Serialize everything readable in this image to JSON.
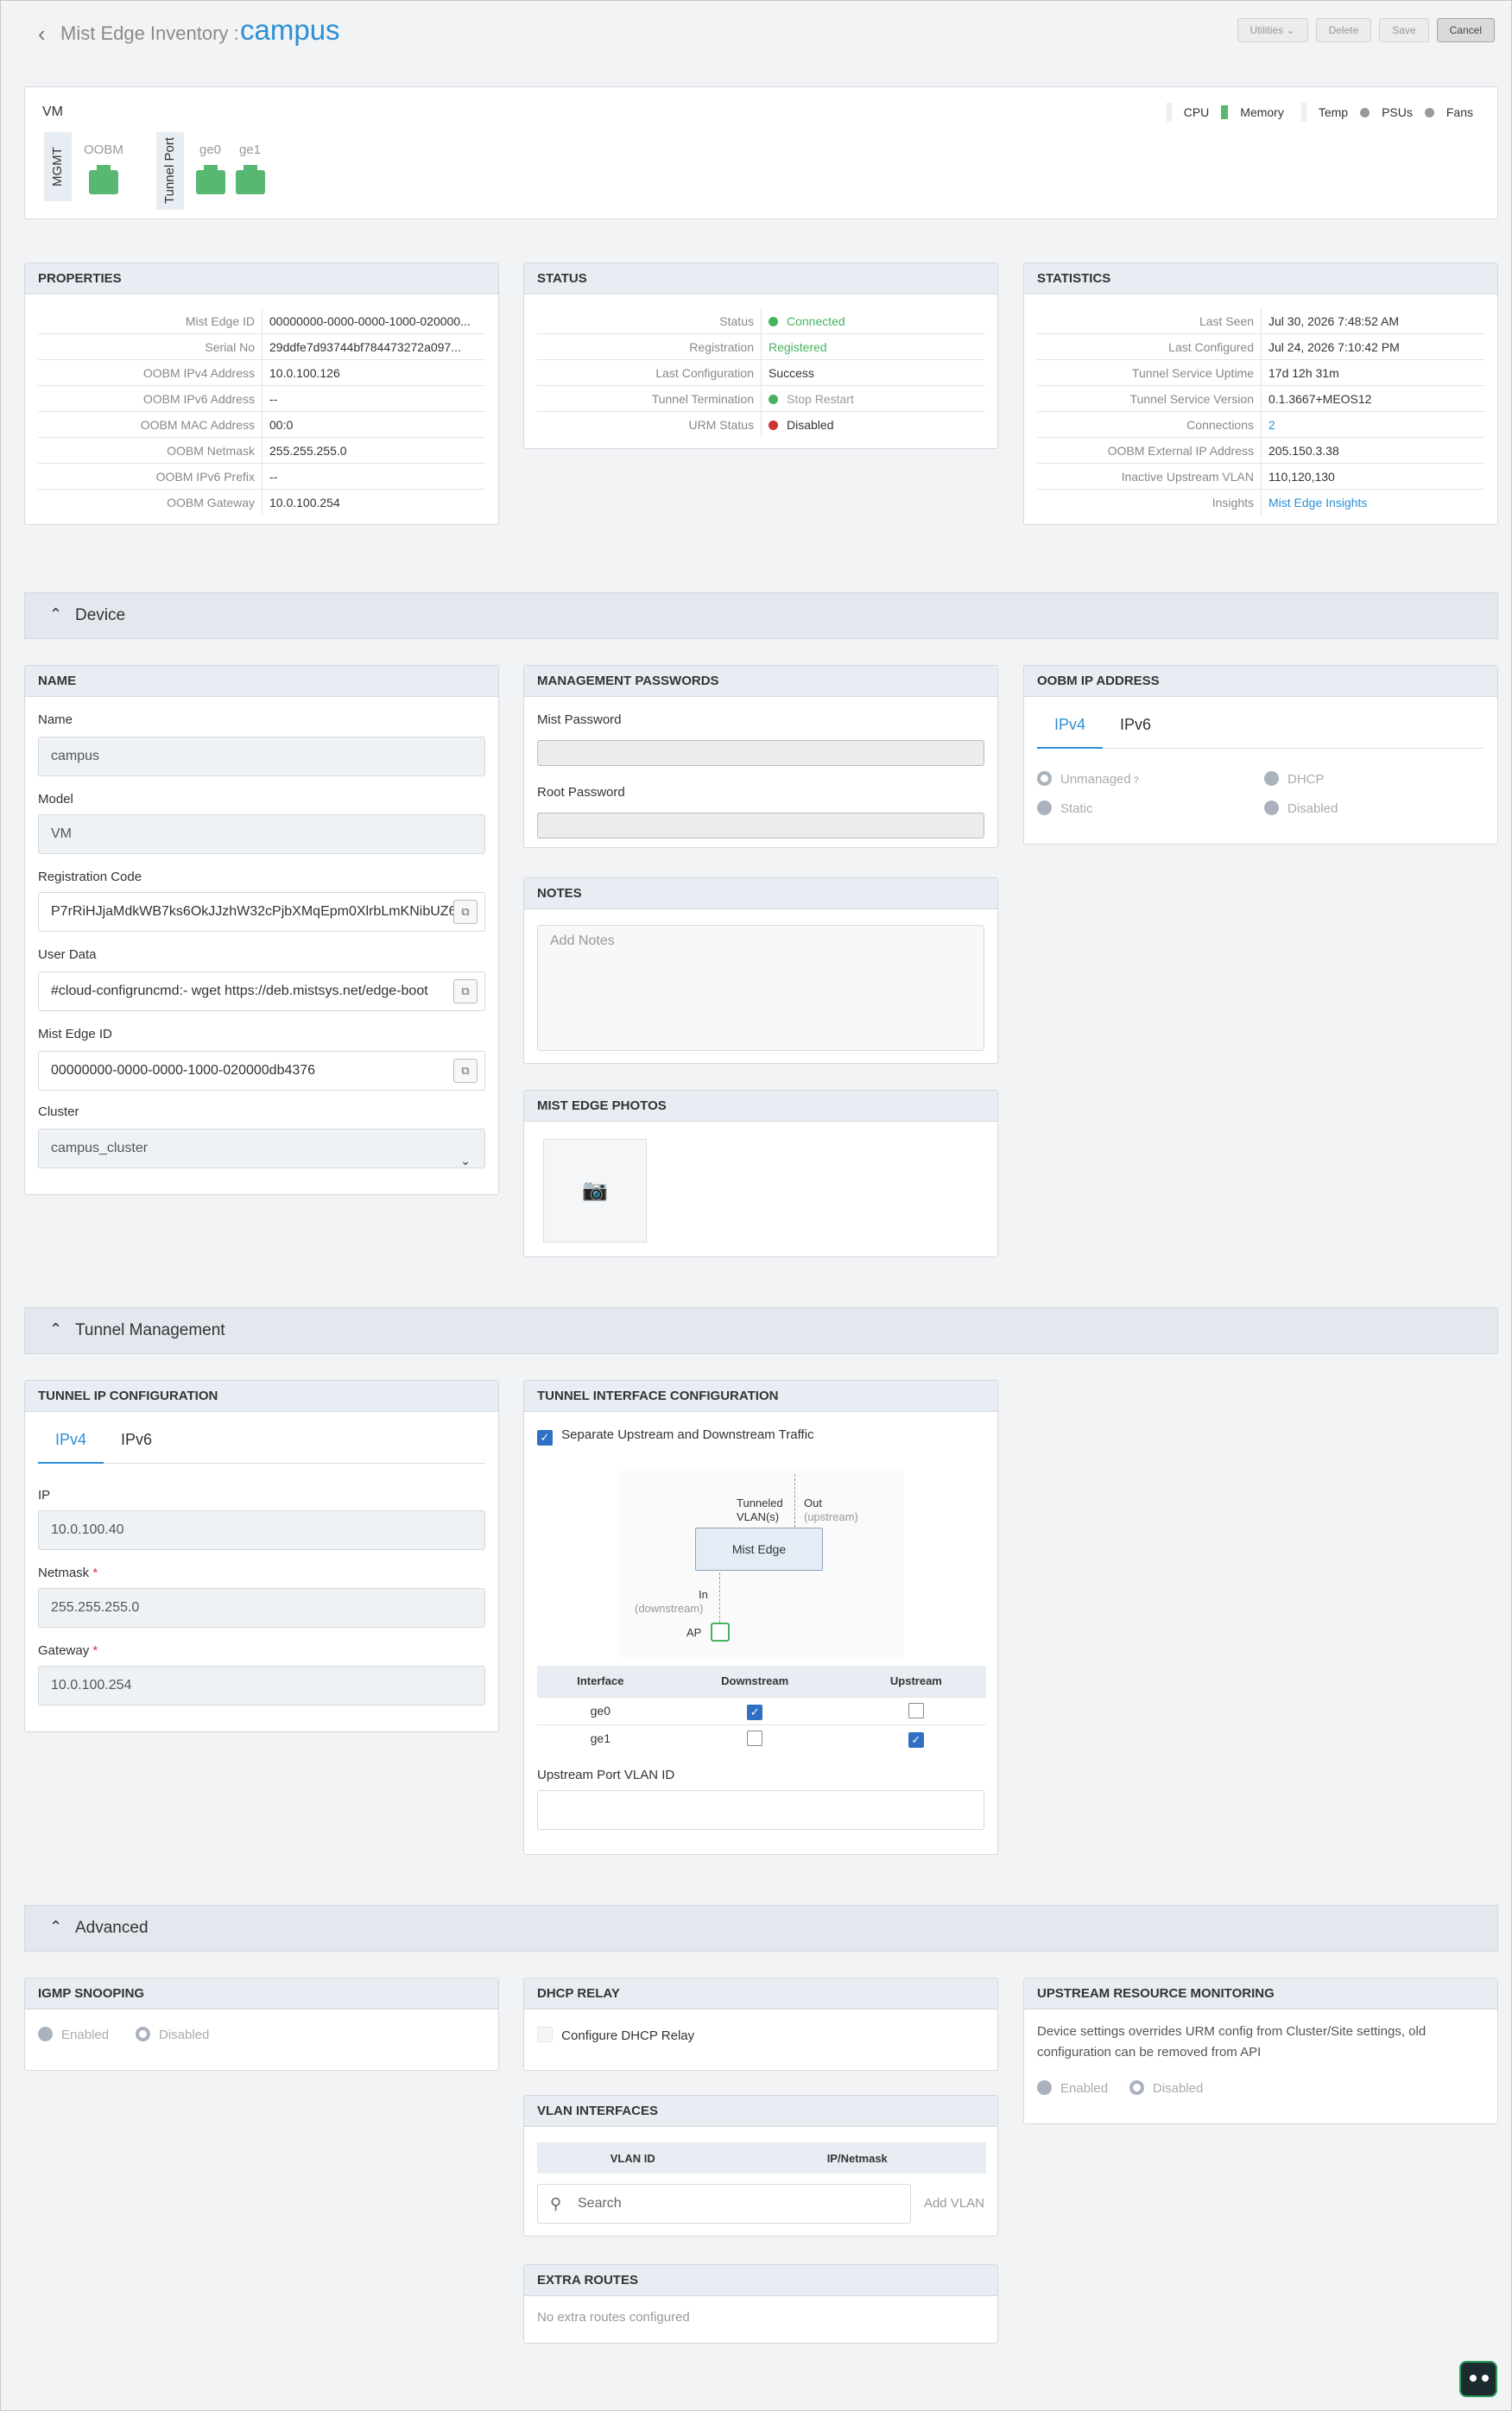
{
  "header": {
    "back_icon": "chevron-left-icon",
    "breadcrumb": "Mist Edge Inventory :",
    "title": "campus",
    "buttons": {
      "utilities": "Utilities ⌄",
      "delete": "Delete",
      "save": "Save",
      "cancel": "Cancel"
    }
  },
  "vm": {
    "label": "VM",
    "legend": [
      "CPU",
      "Memory",
      "Temp",
      "PSUs",
      "Fans"
    ],
    "mgmt_label": "MGMT",
    "oobm_label": "OOBM",
    "tunnel_label": "Tunnel Port",
    "ports": [
      "ge0",
      "ge1"
    ],
    "port_color": "#58b872"
  },
  "properties": {
    "title": "PROPERTIES",
    "rows": [
      {
        "k": "Mist Edge ID",
        "v": "00000000-0000-0000-1000-020000..."
      },
      {
        "k": "Serial No",
        "v": "29ddfe7d93744bf784473272a097..."
      },
      {
        "k": "OOBM IPv4 Address",
        "v": "10.0.100.126"
      },
      {
        "k": "OOBM IPv6 Address",
        "v": "--"
      },
      {
        "k": "OOBM MAC Address",
        "v": "00:0"
      },
      {
        "k": "OOBM Netmask",
        "v": "255.255.255.0"
      },
      {
        "k": "OOBM IPv6 Prefix",
        "v": "--"
      },
      {
        "k": "OOBM Gateway",
        "v": "10.0.100.254"
      }
    ]
  },
  "status": {
    "title": "STATUS",
    "rows": [
      {
        "k": "Status",
        "v": "Connected"
      },
      {
        "k": "Registration",
        "v": "Registered"
      },
      {
        "k": "Last Configuration",
        "v": "Success"
      },
      {
        "k": "Tunnel Termination",
        "v": "Stop Restart"
      },
      {
        "k": "URM Status",
        "v": "Disabled"
      }
    ],
    "colors": {
      "connected": "#45b35e",
      "disabled": "#cc3333"
    }
  },
  "statistics": {
    "title": "STATISTICS",
    "rows": [
      {
        "k": "Last Seen",
        "v": "Jul 30, 2026 7:48:52 AM"
      },
      {
        "k": "Last Configured",
        "v": "Jul 24, 2026 7:10:42 PM"
      },
      {
        "k": "Tunnel Service Uptime",
        "v": "17d 12h 31m"
      },
      {
        "k": "Tunnel Service Version",
        "v": "0.1.3667+MEOS12"
      },
      {
        "k": "Connections",
        "v": "2"
      },
      {
        "k": "OOBM External IP Address",
        "v": "205.150.3.38"
      },
      {
        "k": "Inactive Upstream VLAN",
        "v": "110,120,130"
      },
      {
        "k": "Insights",
        "v": "Mist Edge Insights"
      }
    ]
  },
  "sections": {
    "device": "Device",
    "tunnel": "Tunnel Management",
    "advanced": "Advanced"
  },
  "name_panel": {
    "title": "NAME",
    "name_label": "Name",
    "name_value": "campus",
    "model_label": "Model",
    "model_value": "VM",
    "reg_label": "Registration Code",
    "reg_value": "P7rRiHJjaMdkWB7ks6OkJJzhW32cPjbXMqEpm0XlrbLmKNibUZ6",
    "userdata_label": "User Data",
    "userdata_value": "#cloud-configruncmd:- wget https://deb.mistsys.net/edge-boot",
    "edgeid_label": "Mist Edge ID",
    "edgeid_value": "00000000-0000-0000-1000-020000db4376",
    "cluster_label": "Cluster",
    "cluster_value": "campus_cluster"
  },
  "passwords": {
    "title": "MANAGEMENT PASSWORDS",
    "mist_label": "Mist Password",
    "root_label": "Root Password"
  },
  "notes": {
    "title": "NOTES",
    "placeholder": "Add Notes"
  },
  "photos": {
    "title": "MIST EDGE PHOTOS"
  },
  "oobm_ip": {
    "title": "OOBM IP ADDRESS",
    "tabs": [
      "IPv4",
      "IPv6"
    ],
    "options": [
      "Unmanaged",
      "DHCP",
      "Static",
      "Disabled"
    ]
  },
  "tunnel_ip": {
    "title": "TUNNEL IP CONFIGURATION",
    "tabs": [
      "IPv4",
      "IPv6"
    ],
    "ip_label": "IP",
    "ip_value": "10.0.100.40",
    "netmask_label": "Netmask",
    "netmask_value": "255.255.255.0",
    "gateway_label": "Gateway",
    "gateway_value": "10.0.100.254"
  },
  "tunnel_iface": {
    "title": "TUNNEL INTERFACE CONFIGURATION",
    "separate_label": "Separate Upstream and Downstream Traffic",
    "diagram": {
      "tunneled": "Tunneled",
      "vlans": "VLAN(s)",
      "out": "Out",
      "upstream": "(upstream)",
      "mist_edge": "Mist Edge",
      "in": "In",
      "downstream": "(downstream)",
      "ap": "AP"
    },
    "columns": [
      "Interface",
      "Downstream",
      "Upstream"
    ],
    "rows": [
      {
        "iface": "ge0",
        "down": true,
        "up": false
      },
      {
        "iface": "ge1",
        "down": false,
        "up": true
      }
    ],
    "vlan_label": "Upstream Port VLAN ID"
  },
  "igmp": {
    "title": "IGMP SNOOPING",
    "options": [
      "Enabled",
      "Disabled"
    ]
  },
  "dhcp": {
    "title": "DHCP RELAY",
    "label": "Configure DHCP Relay"
  },
  "vlan_ifaces": {
    "title": "VLAN INTERFACES",
    "columns": [
      "VLAN ID",
      "IP/Netmask"
    ],
    "search_placeholder": "Search",
    "add": "Add VLAN"
  },
  "extra_routes": {
    "title": "EXTRA ROUTES",
    "empty": "No extra routes configured"
  },
  "urm": {
    "title": "UPSTREAM RESOURCE MONITORING",
    "desc": "Device settings overrides URM config from Cluster/Site settings, old configuration can be removed from API",
    "options": [
      "Enabled",
      "Disabled"
    ]
  },
  "chatbot": {
    "icon": "chatbot-icon"
  }
}
